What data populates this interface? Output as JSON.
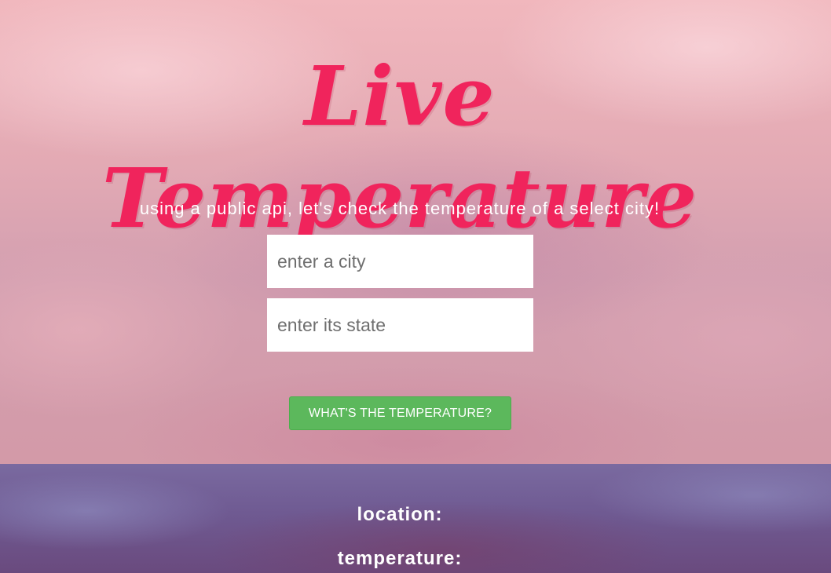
{
  "header": {
    "title": "Live Temperature",
    "subtitle": "using a public api, let's check the temperature of a select city!"
  },
  "form": {
    "city_placeholder": "enter a city",
    "city_value": "",
    "state_placeholder": "enter its state",
    "state_value": "",
    "submit_label": "WHAT'S THE TEMPERATURE?"
  },
  "results": {
    "location_label": "location:",
    "temperature_label": "temperature:"
  },
  "colors": {
    "title": "#f0245c",
    "button": "#5cb85c",
    "results_band": "#6f5a92"
  }
}
